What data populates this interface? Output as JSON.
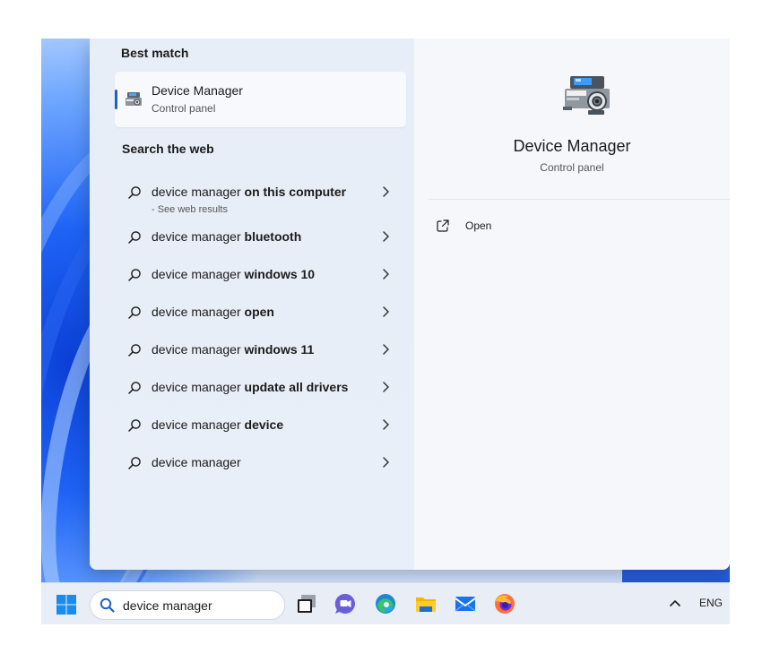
{
  "best_match": {
    "heading": "Best match",
    "title": "Device Manager",
    "subtitle": "Control panel",
    "icon": "device-manager-icon"
  },
  "web": {
    "heading": "Search the web",
    "items": [
      {
        "prefix": "device manager",
        "bold": " on this computer",
        "sub": "- See web results"
      },
      {
        "prefix": "device manager",
        "bold": " bluetooth",
        "sub": ""
      },
      {
        "prefix": "device manager",
        "bold": " windows 10",
        "sub": ""
      },
      {
        "prefix": "device manager",
        "bold": " open",
        "sub": ""
      },
      {
        "prefix": "device manager",
        "bold": " windows 11",
        "sub": ""
      },
      {
        "prefix": "device manager",
        "bold": " update all drivers",
        "sub": ""
      },
      {
        "prefix": "device manager",
        "bold": " device",
        "sub": ""
      },
      {
        "prefix": "device manager",
        "bold": "",
        "sub": ""
      }
    ]
  },
  "detail": {
    "title": "Device Manager",
    "subtitle": "Control panel",
    "open_label": "Open"
  },
  "taskbar": {
    "search_value": "device manager",
    "apps": [
      "task-view-icon",
      "teams-chat-icon",
      "edge-icon",
      "file-explorer-icon",
      "mail-icon",
      "firefox-icon"
    ],
    "language": "ENG"
  },
  "colors": {
    "accent": "#1f5fcc",
    "panel_left": "#e8eef8",
    "panel_right": "#f5f7fb",
    "taskbar": "#e9eef6"
  }
}
